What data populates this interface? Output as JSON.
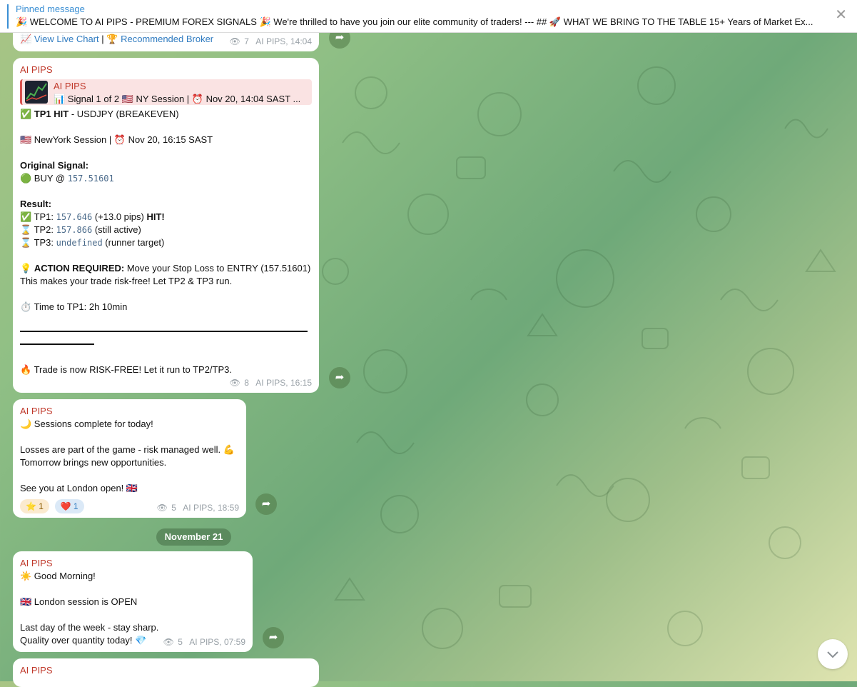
{
  "pinned": {
    "title": "Pinned message",
    "text": "🎉 WELCOME TO AI PIPS - PREMIUM FOREX SIGNALS 🎉  We're thrilled to have you join our elite community of traders!  ---  ## 🚀 WHAT WE BRING TO THE TABLE  15+ Years of Market Ex..."
  },
  "top_bubble": {
    "chart_link": "View Live Chart",
    "separator": "|",
    "broker_link": "Recommended Broker",
    "views": "7",
    "meta": "AI PIPS, 14:04"
  },
  "msg1": {
    "sender": "AI PIPS",
    "reply_name": "AI PIPS",
    "reply_text": "📊 Signal 1 of 2 🇺🇸 NY Session | ⏰ Nov 20, 14:04 SAST ...",
    "tp1_hit_bold": "TP1 HIT",
    "tp1_hit_rest": " - USDJPY (BREAKEVEN)",
    "session": "🇺🇸 NewYork Session | ⏰ Nov 20, 16:15 SAST",
    "original_label": "Original Signal:",
    "buy_prefix": "🟢 BUY @ ",
    "buy_price": "157.51601",
    "result_label": "Result:",
    "tp1_prefix": "✅ TP1: ",
    "tp1_value": "157.646",
    "tp1_mid": " (+13.0 pips) ",
    "tp1_hit": "HIT!",
    "tp2_prefix": "⌛ TP2: ",
    "tp2_value": "157.866",
    "tp2_suffix": " (still active)",
    "tp3_prefix": "⌛ TP3: ",
    "tp3_value": "undefined",
    "tp3_suffix": " (runner target)",
    "action_bold": "ACTION REQUIRED:",
    "action_rest": " Move your Stop Loss to ENTRY (157.51601)",
    "risk_free": "This makes your trade risk-free! Let TP2 & TP3 run.",
    "time_to_tp1": "⏱️ Time to TP1: 2h 10min",
    "final": "🔥 Trade is now RISK-FREE! Let it run to TP2/TP3.",
    "views": "8",
    "meta": "AI PIPS, 16:15"
  },
  "msg2": {
    "sender": "AI PIPS",
    "line1": "🌙 Sessions complete for today!",
    "line2": "Losses are part of the game - risk managed well. 💪",
    "line3": "Tomorrow brings new opportunities.",
    "line4": "See you at London open! 🇬🇧",
    "react_star": "⭐ 1",
    "react_heart": "❤️ 1",
    "views": "5",
    "meta": "AI PIPS, 18:59"
  },
  "date_divider": "November 21",
  "msg3": {
    "sender": "AI PIPS",
    "line1": "☀️ Good Morning!",
    "line2": "🇬🇧 London session is OPEN",
    "line3": "Last day of the week - stay sharp.",
    "line4": "Quality over quantity today! 💎",
    "views": "5",
    "meta": "AI PIPS, 07:59"
  },
  "msg4": {
    "sender": "AI PIPS"
  },
  "icons": {
    "forward": "forward-icon",
    "eye": "eye-icon",
    "close": "close-icon",
    "scroll": "chevron-down-icon"
  },
  "colors": {
    "accent": "#3a8fd4",
    "sender": "#c0392b",
    "reply_bg": "#fae3e3"
  }
}
